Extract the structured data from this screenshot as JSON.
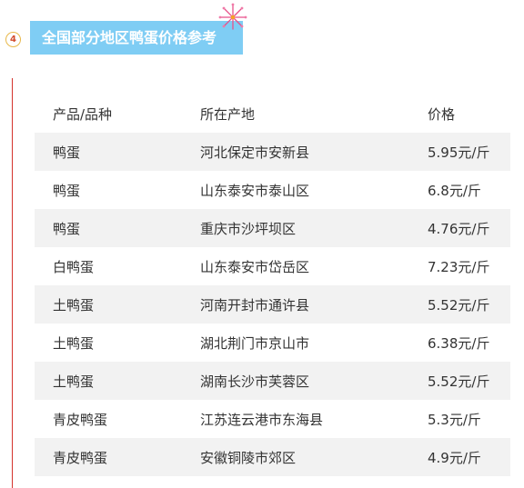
{
  "section": {
    "number": "4",
    "title": "全国部分地区鸭蛋价格参考"
  },
  "table": {
    "headers": [
      "产品/品种",
      "所在产地",
      "价格"
    ],
    "rows": [
      [
        "鸭蛋",
        "河北保定市安新县",
        "5.95元/斤"
      ],
      [
        "鸭蛋",
        "山东泰安市泰山区",
        "6.8元/斤"
      ],
      [
        "鸭蛋",
        "重庆市沙坪坝区",
        "4.76元/斤"
      ],
      [
        "白鸭蛋",
        "山东泰安市岱岳区",
        "7.23元/斤"
      ],
      [
        "土鸭蛋",
        "河南开封市通许县",
        "5.52元/斤"
      ],
      [
        "土鸭蛋",
        "湖北荆门市京山市",
        "6.38元/斤"
      ],
      [
        "土鸭蛋",
        "湖南长沙市芙蓉区",
        "5.52元/斤"
      ],
      [
        "青皮鸭蛋",
        "江苏连云港市东海县",
        "5.3元/斤"
      ],
      [
        "青皮鸭蛋",
        "安徽铜陵市郊区",
        "4.9元/斤"
      ]
    ]
  },
  "colors": {
    "title_bg": "#7fcdf4",
    "accent_line": "#d4332c",
    "row_alt_bg": "#f2f2f2"
  },
  "icons": [
    "firework-icon"
  ]
}
